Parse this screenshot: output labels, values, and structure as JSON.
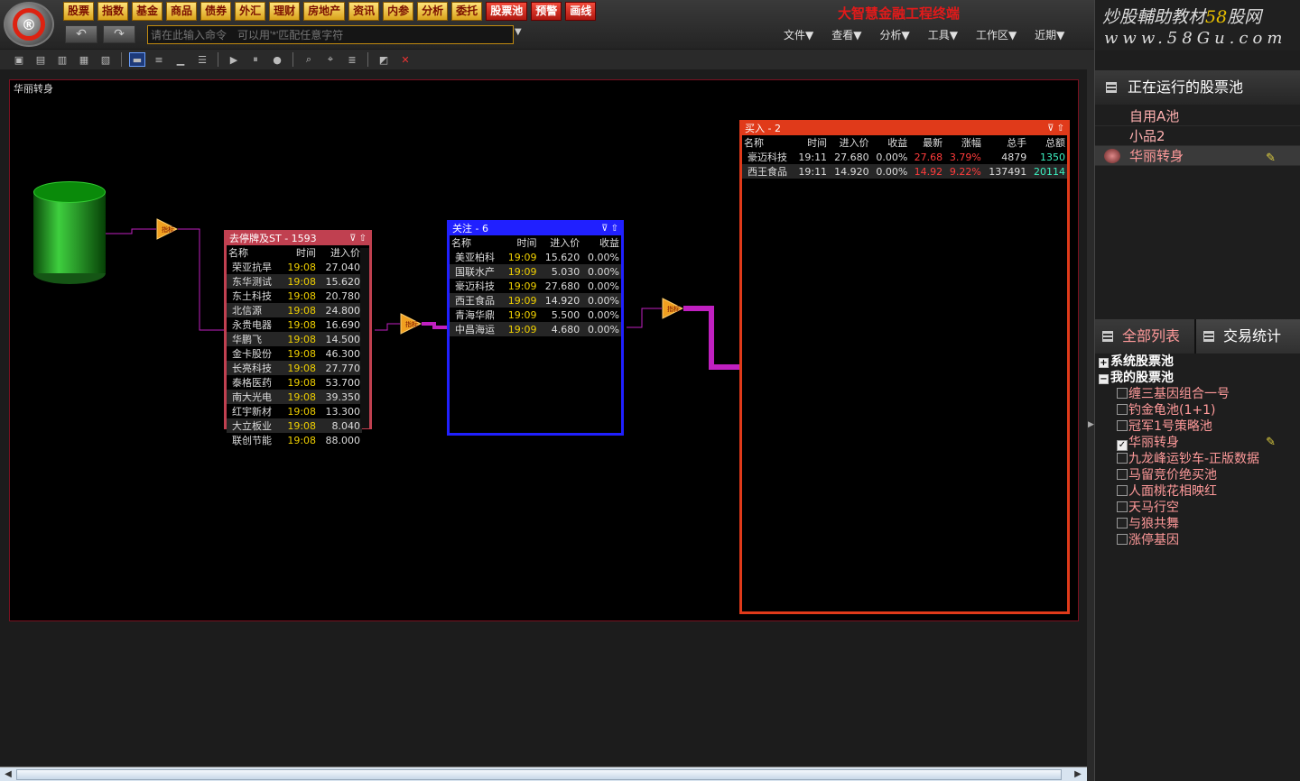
{
  "menu_buttons": [
    "股票",
    "指数",
    "基金",
    "商品",
    "债券",
    "外汇",
    "理财",
    "房地产",
    "资讯",
    "内参",
    "分析",
    "委托"
  ],
  "red_buttons": [
    "股票池",
    "预警",
    "画线"
  ],
  "command": {
    "placeholder": "请在此输入命令　可以用'*'匹配任意字符"
  },
  "app_title": "大智慧金融工程终端",
  "top_menu": [
    "文件▼",
    "查看▼",
    "分析▼",
    "工具▼",
    "工作区▼",
    "近期▼"
  ],
  "brand": {
    "line1_a": "炒股輔助教材",
    "line1_b": "58",
    "line1_c": "股网",
    "line2": "www.58Gu.com"
  },
  "canvas_title": "华丽转身",
  "filters": {
    "f1": "指标",
    "f2": "指标",
    "f3": "指标"
  },
  "panel1": {
    "title": "去停牌及ST - 1593",
    "headers": [
      "名称",
      "时间",
      "进入价"
    ],
    "rows": [
      [
        "荣亚抗旱",
        "19:08",
        "27.040"
      ],
      [
        "东华测试",
        "19:08",
        "15.620"
      ],
      [
        "东土科技",
        "19:08",
        "20.780"
      ],
      [
        "北信源",
        "19:08",
        "24.800"
      ],
      [
        "永贵电器",
        "19:08",
        "16.690"
      ],
      [
        "华鹏飞",
        "19:08",
        "14.500"
      ],
      [
        "金卡股份",
        "19:08",
        "46.300"
      ],
      [
        "长亮科技",
        "19:08",
        "27.770"
      ],
      [
        "泰格医药",
        "19:08",
        "53.700"
      ],
      [
        "南大光电",
        "19:08",
        "39.350"
      ],
      [
        "红宇新材",
        "19:08",
        "13.300"
      ],
      [
        "大立板业",
        "19:08",
        "8.040"
      ],
      [
        "联创节能",
        "19:08",
        "88.000"
      ]
    ]
  },
  "panel2": {
    "title": "关注 - 6",
    "headers": [
      "名称",
      "时间",
      "进入价",
      "收益"
    ],
    "rows": [
      [
        "美亚柏科",
        "19:09",
        "15.620",
        "0.00%"
      ],
      [
        "国联水产",
        "19:09",
        "5.030",
        "0.00%"
      ],
      [
        "豪迈科技",
        "19:09",
        "27.680",
        "0.00%"
      ],
      [
        "西王食品",
        "19:09",
        "14.920",
        "0.00%"
      ],
      [
        "青海华鼎",
        "19:09",
        "5.500",
        "0.00%"
      ],
      [
        "中昌海运",
        "19:09",
        "4.680",
        "0.00%"
      ]
    ]
  },
  "panel3": {
    "title": "买入 - 2",
    "headers": [
      "名称",
      "时间",
      "进入价",
      "收益",
      "最新",
      "涨幅",
      "总手",
      "总额"
    ],
    "rows": [
      [
        "豪迈科技",
        "19:11",
        "27.680",
        "0.00%",
        "27.68",
        "3.79%",
        "4879",
        "1350"
      ],
      [
        "西王食品",
        "19:11",
        "14.920",
        "0.00%",
        "14.92",
        "9.22%",
        "137491",
        "20114"
      ]
    ]
  },
  "sidebar": {
    "running_title": "正在运行的股票池",
    "running": [
      "自用A池",
      "小品2",
      "华丽转身"
    ],
    "tab_all": "全部列表",
    "tab_stats": "交易统计",
    "group_system": "系统股票池",
    "group_mine": "我的股票池",
    "my_pools": [
      "缠三基因组合一号",
      "钓金龟池(1+1)",
      "冠军1号策略池",
      "华丽转身",
      "九龙峰运钞车-正版数据",
      "马留竞价绝买池",
      "人面桃花相映红",
      "天马行空",
      "与狼共舞",
      "涨停基因"
    ],
    "checked_pool": "华丽转身"
  },
  "colors": {
    "accent_yellow": "#f0d000",
    "up_red": "#ff3b3b",
    "panel_blue": "#2020ff",
    "panel_red": "#e03a1a",
    "link_magenta": "#c020c0"
  }
}
